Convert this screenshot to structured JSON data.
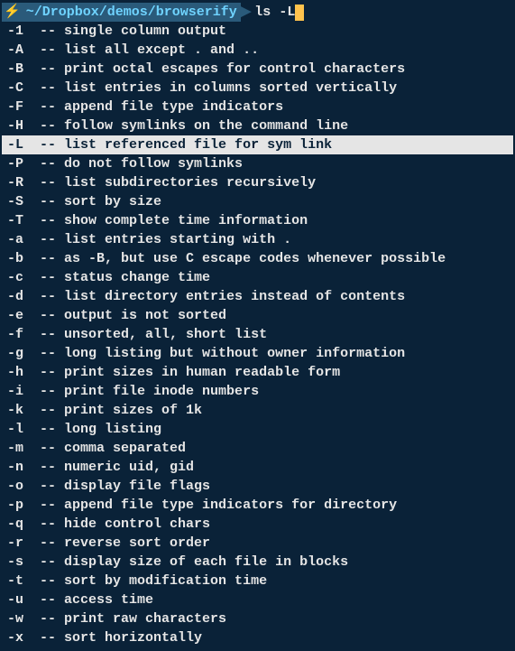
{
  "prompt": {
    "icon": "⚡",
    "path": "~/Dropbox/demos/browserify",
    "arrow": "▶",
    "command": "ls",
    "arg": "-L"
  },
  "options": [
    {
      "flag": "-1",
      "sep": "  -- ",
      "desc": "single column output",
      "hl": false
    },
    {
      "flag": "-A",
      "sep": "  -- ",
      "desc": "list all except . and ..",
      "hl": false
    },
    {
      "flag": "-B",
      "sep": "  -- ",
      "desc": "print octal escapes for control characters",
      "hl": false
    },
    {
      "flag": "-C",
      "sep": "  -- ",
      "desc": "list entries in columns sorted vertically",
      "hl": false
    },
    {
      "flag": "-F",
      "sep": "  -- ",
      "desc": "append file type indicators",
      "hl": false
    },
    {
      "flag": "-H",
      "sep": "  -- ",
      "desc": "follow symlinks on the command line",
      "hl": false
    },
    {
      "flag": "-L",
      "sep": "  -- ",
      "desc": "list referenced file for sym link",
      "hl": true
    },
    {
      "flag": "-P",
      "sep": "  -- ",
      "desc": "do not follow symlinks",
      "hl": false
    },
    {
      "flag": "-R",
      "sep": "  -- ",
      "desc": "list subdirectories recursively",
      "hl": false
    },
    {
      "flag": "-S",
      "sep": "  -- ",
      "desc": "sort by size",
      "hl": false
    },
    {
      "flag": "-T",
      "sep": "  -- ",
      "desc": "show complete time information",
      "hl": false
    },
    {
      "flag": "-a",
      "sep": "  -- ",
      "desc": "list entries starting with .",
      "hl": false
    },
    {
      "flag": "-b",
      "sep": "  -- ",
      "desc": "as -B, but use C escape codes whenever possible",
      "hl": false
    },
    {
      "flag": "-c",
      "sep": "  -- ",
      "desc": "status change time",
      "hl": false
    },
    {
      "flag": "-d",
      "sep": "  -- ",
      "desc": "list directory entries instead of contents",
      "hl": false
    },
    {
      "flag": "-e",
      "sep": "  -- ",
      "desc": "output is not sorted",
      "hl": false
    },
    {
      "flag": "-f",
      "sep": "  -- ",
      "desc": "unsorted, all, short list",
      "hl": false
    },
    {
      "flag": "-g",
      "sep": "  -- ",
      "desc": "long listing but without owner information",
      "hl": false
    },
    {
      "flag": "-h",
      "sep": "  -- ",
      "desc": "print sizes in human readable form",
      "hl": false
    },
    {
      "flag": "-i",
      "sep": "  -- ",
      "desc": "print file inode numbers",
      "hl": false
    },
    {
      "flag": "-k",
      "sep": "  -- ",
      "desc": "print sizes of 1k",
      "hl": false
    },
    {
      "flag": "-l",
      "sep": "  -- ",
      "desc": "long listing",
      "hl": false
    },
    {
      "flag": "-m",
      "sep": "  -- ",
      "desc": "comma separated",
      "hl": false
    },
    {
      "flag": "-n",
      "sep": "  -- ",
      "desc": "numeric uid, gid",
      "hl": false
    },
    {
      "flag": "-o",
      "sep": "  -- ",
      "desc": "display file flags",
      "hl": false
    },
    {
      "flag": "-p",
      "sep": "  -- ",
      "desc": "append file type indicators for directory",
      "hl": false
    },
    {
      "flag": "-q",
      "sep": "  -- ",
      "desc": "hide control chars",
      "hl": false
    },
    {
      "flag": "-r",
      "sep": "  -- ",
      "desc": "reverse sort order",
      "hl": false
    },
    {
      "flag": "-s",
      "sep": "  -- ",
      "desc": "display size of each file in blocks",
      "hl": false
    },
    {
      "flag": "-t",
      "sep": "  -- ",
      "desc": "sort by modification time",
      "hl": false
    },
    {
      "flag": "-u",
      "sep": "  -- ",
      "desc": "access time",
      "hl": false
    },
    {
      "flag": "-w",
      "sep": "  -- ",
      "desc": "print raw characters",
      "hl": false
    },
    {
      "flag": "-x",
      "sep": "  -- ",
      "desc": "sort horizontally",
      "hl": false
    }
  ]
}
